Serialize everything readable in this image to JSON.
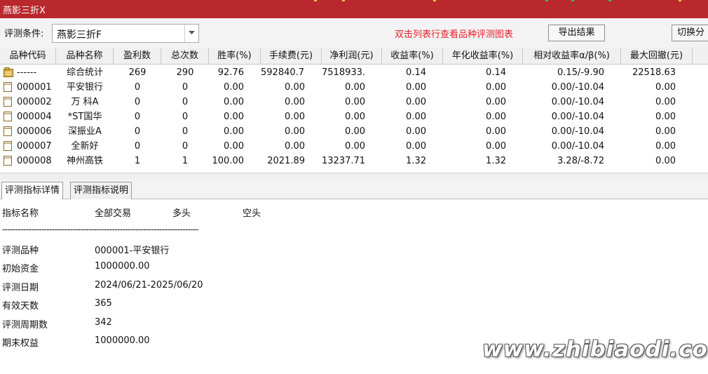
{
  "window": {
    "title": "燕影三折X"
  },
  "toolbar": {
    "condition_label": "评测条件:",
    "condition_value": "燕影三折F",
    "hint": "双击列表行查看品种评测图表",
    "export_label": "导出结果",
    "switch_label": "切换分"
  },
  "table": {
    "headers": [
      "品种代码",
      "品种名称",
      "盈利数",
      "总次数",
      "胜率(%)",
      "手续费(元)",
      "净利润(元)",
      "收益率(%)",
      "年化收益率(%)",
      "相对收益率α/β(%)",
      "最大回撤(元)"
    ],
    "rows": [
      {
        "code": "------",
        "name": "综合统计",
        "wins": "269",
        "total": "290",
        "win_rate": "92.76",
        "fee": "592840.71",
        "net_profit": "7518933....",
        "return": "0.14",
        "annual_return": "0.14",
        "alpha_beta": "0.15/-9.90",
        "max_drawdown": "22518.63",
        "icon": "summary-folder-icon"
      },
      {
        "code": "000001",
        "name": "平安银行",
        "wins": "0",
        "total": "0",
        "win_rate": "0.00",
        "fee": "0.00",
        "net_profit": "0.00",
        "return": "0.00",
        "annual_return": "0.00",
        "alpha_beta": "0.00/-10.04",
        "max_drawdown": "0.00",
        "icon": "document-icon"
      },
      {
        "code": "000002",
        "name": "万 科A",
        "wins": "0",
        "total": "0",
        "win_rate": "0.00",
        "fee": "0.00",
        "net_profit": "0.00",
        "return": "0.00",
        "annual_return": "0.00",
        "alpha_beta": "0.00/-10.04",
        "max_drawdown": "0.00",
        "icon": "document-icon"
      },
      {
        "code": "000004",
        "name": "*ST国华",
        "wins": "0",
        "total": "0",
        "win_rate": "0.00",
        "fee": "0.00",
        "net_profit": "0.00",
        "return": "0.00",
        "annual_return": "0.00",
        "alpha_beta": "0.00/-10.04",
        "max_drawdown": "0.00",
        "icon": "document-icon"
      },
      {
        "code": "000006",
        "name": "深振业A",
        "wins": "0",
        "total": "0",
        "win_rate": "0.00",
        "fee": "0.00",
        "net_profit": "0.00",
        "return": "0.00",
        "annual_return": "0.00",
        "alpha_beta": "0.00/-10.04",
        "max_drawdown": "0.00",
        "icon": "document-icon"
      },
      {
        "code": "000007",
        "name": "全新好",
        "wins": "0",
        "total": "0",
        "win_rate": "0.00",
        "fee": "0.00",
        "net_profit": "0.00",
        "return": "0.00",
        "annual_return": "0.00",
        "alpha_beta": "0.00/-10.04",
        "max_drawdown": "0.00",
        "icon": "document-icon"
      },
      {
        "code": "000008",
        "name": "神州高铁",
        "wins": "1",
        "total": "1",
        "win_rate": "100.00",
        "fee": "2021.89",
        "net_profit": "13237.71",
        "return": "1.32",
        "annual_return": "1.32",
        "alpha_beta": "3.28/-8.72",
        "max_drawdown": "0.00",
        "icon": "document-icon"
      }
    ]
  },
  "tabs": [
    {
      "label": "评测指标详情",
      "active": true
    },
    {
      "label": "评测指标说明",
      "active": false
    }
  ],
  "details": {
    "columns": [
      "指标名称",
      "全部交易",
      "多头",
      "空头"
    ],
    "divider": "---------------------------------------------------------------------------",
    "rows": [
      {
        "label": "评测品种",
        "value": "000001-平安银行"
      },
      {
        "label": "初始资金",
        "value": "1000000.00"
      },
      {
        "label": "评测日期",
        "value": "2024/06/21-2025/06/20"
      },
      {
        "label": "有效天数",
        "value": "365"
      },
      {
        "label": "评测周期数",
        "value": "342"
      },
      {
        "label": "期末权益",
        "value": "1000000.00"
      }
    ]
  },
  "watermark": "www.zhibiaodi.com",
  "colors": {
    "titlebar": "#b9282c",
    "hint": "#e8202a",
    "folder": "#e0b341",
    "icon_outline": "#8a6a2a"
  }
}
